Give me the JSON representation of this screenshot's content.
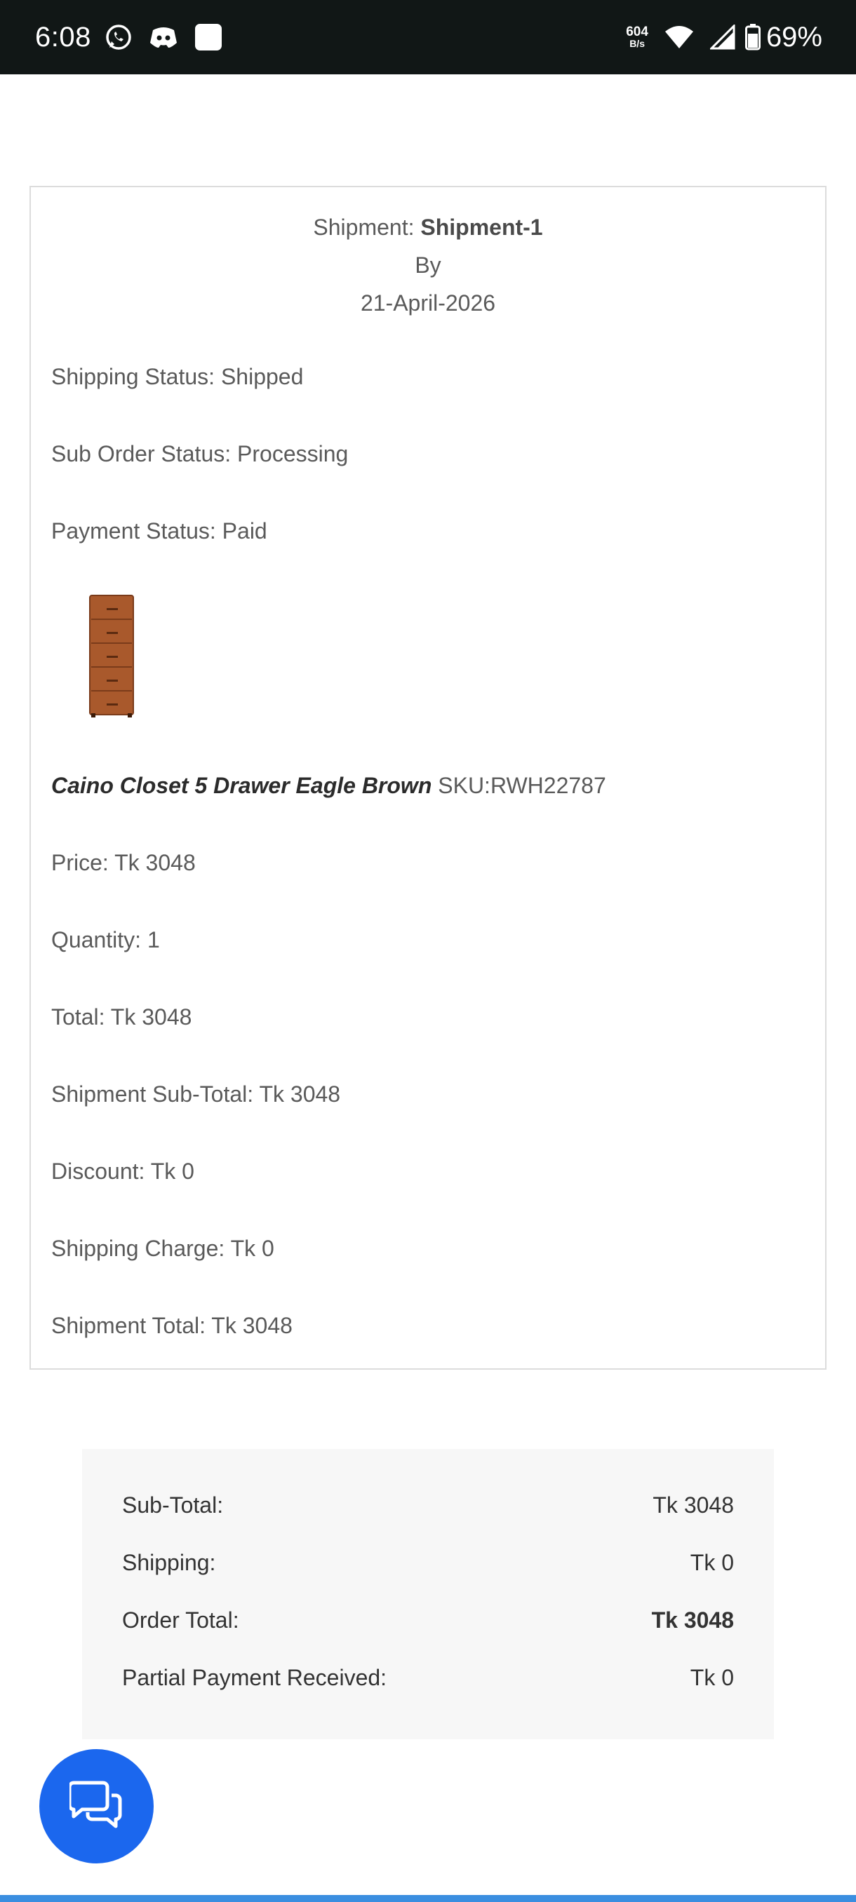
{
  "status_bar": {
    "time": "6:08",
    "net_speed_value": "604",
    "net_speed_unit": "B/s",
    "battery": "69%"
  },
  "shipment": {
    "label": "Shipment:",
    "name": "Shipment-1",
    "by": "By",
    "date": "21-April-2026",
    "shipping_status": "Shipping Status: Shipped",
    "sub_order_status": "Sub Order Status: Processing",
    "payment_status": "Payment Status: Paid",
    "product": {
      "name": "Caino Closet 5 Drawer Eagle Brown",
      "sku": "SKU:RWH22787",
      "price": "Price: Tk 3048",
      "quantity": "Quantity: 1",
      "total": "Total: Tk 3048"
    },
    "sub_total": "Shipment Sub-Total: Tk 3048",
    "discount": "Discount: Tk 0",
    "shipping_charge": "Shipping Charge: Tk 0",
    "shipment_total": "Shipment Total: Tk 3048"
  },
  "order_summary": {
    "rows": [
      {
        "label": "Sub-Total:",
        "value": "Tk 3048"
      },
      {
        "label": "Shipping:",
        "value": "Tk 0"
      },
      {
        "label": "Order Total:",
        "value": "Tk 3048"
      },
      {
        "label": "Partial Payment Received:",
        "value": "Tk 0"
      }
    ]
  },
  "colors": {
    "status_bar_bg": "#111716",
    "fab_bg": "#1b67ee",
    "summary_bg": "#f7f7f7",
    "bottom_bar": "#3a8ee0"
  },
  "icons": {
    "whatsapp": "whatsapp-icon",
    "discord": "discord-icon",
    "app": "app-square-icon",
    "wifi": "wifi-icon",
    "signal": "signal-icon",
    "battery": "battery-icon",
    "chat": "chat-bubbles-icon"
  }
}
